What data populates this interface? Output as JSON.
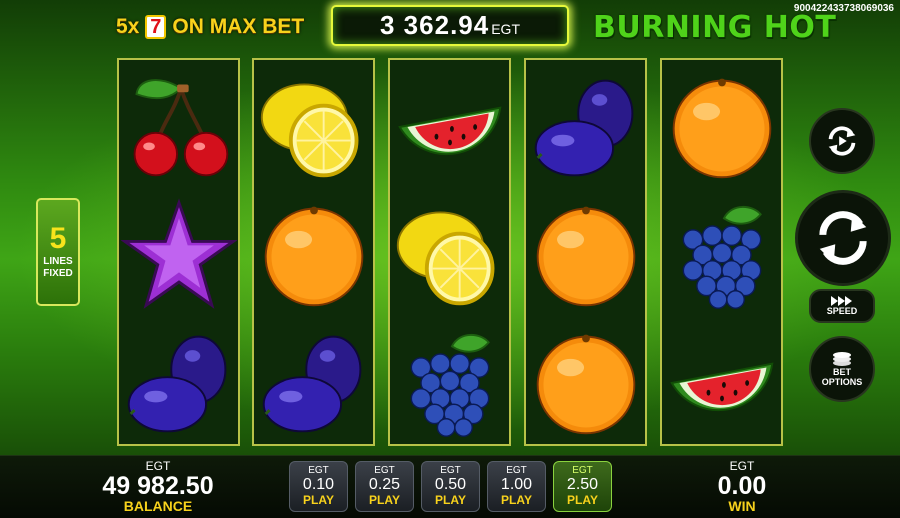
{
  "header": {
    "promo_multiplier": "5x",
    "promo_symbol": "7",
    "promo_text": "ON MAX BET",
    "jackpot_value": "3 362.94",
    "jackpot_currency": "EGT",
    "logo": "BURNING HOT",
    "game_id": "9004224337380690​36"
  },
  "lines": {
    "count": "5",
    "label_line1": "LINES",
    "label_line2": "FIXED"
  },
  "reels": [
    [
      "cherry",
      "star",
      "plum"
    ],
    [
      "lemon",
      "orange",
      "plum"
    ],
    [
      "watermelon",
      "lemon",
      "grape"
    ],
    [
      "plum",
      "orange",
      "orange"
    ],
    [
      "orange",
      "grape",
      "watermelon"
    ]
  ],
  "controls": {
    "speed_label": "SPEED",
    "bet_options_line1": "BET",
    "bet_options_line2": "OPTIONS"
  },
  "balance": {
    "currency": "EGT",
    "value": "49 982.50",
    "label": "BALANCE"
  },
  "win": {
    "currency": "EGT",
    "value": "0.00",
    "label": "WIN"
  },
  "bets": [
    {
      "currency": "EGT",
      "value": "0.10",
      "label": "PLAY",
      "active": false
    },
    {
      "currency": "EGT",
      "value": "0.25",
      "label": "PLAY",
      "active": false
    },
    {
      "currency": "EGT",
      "value": "0.50",
      "label": "PLAY",
      "active": false
    },
    {
      "currency": "EGT",
      "value": "1.00",
      "label": "PLAY",
      "active": false
    },
    {
      "currency": "EGT",
      "value": "2.50",
      "label": "PLAY",
      "active": true
    }
  ],
  "colors": {
    "accent_yellow": "#f8d21c",
    "logo_green": "#4fd31a",
    "reel_border": "#b7c248"
  }
}
